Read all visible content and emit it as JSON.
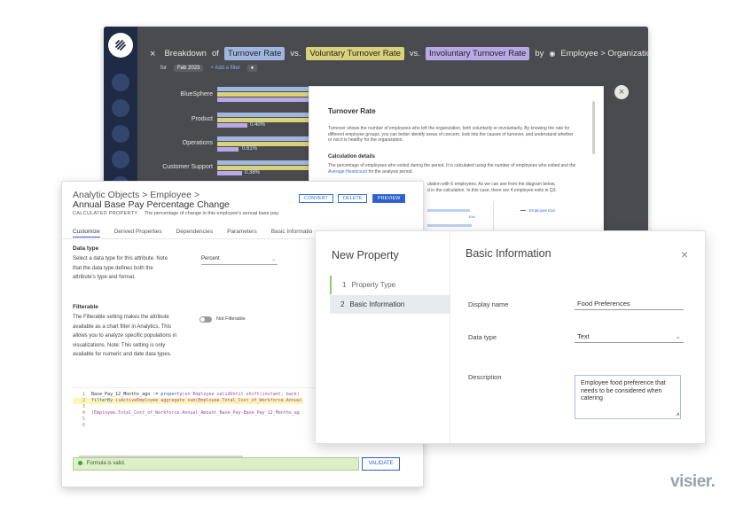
{
  "back_window": {
    "breadcrumb": {
      "close": "×",
      "w1": "Breakdown",
      "w2": "of",
      "metric1": "Turnover Rate",
      "vs1": "vs.",
      "metric2": "Voluntary Turnover Rate",
      "vs2": "vs.",
      "metric3": "Involuntary Turnover Rate",
      "by": "by",
      "dim_icon": "eye-icon",
      "dimension": "Employee > Organization Hierarchy"
    },
    "filters": {
      "for": "for",
      "period": "Feb 2023",
      "add": "+ Add a filter",
      "more": "♦"
    },
    "chart_data": {
      "type": "bar",
      "categories": [
        "BlueSphere",
        "Product",
        "Operations",
        "Customer Support"
      ],
      "data_labels": [
        "",
        "0.40%",
        "0.61%",
        "0.38%"
      ],
      "colors": {
        "series_a": "#9fb7e0",
        "series_b": "#d9d27a",
        "series_c": "#b8a9e6"
      }
    }
  },
  "turnover_panel": {
    "title": "Turnover Rate",
    "intro": "Turnover shows the number of employees who left the organization, both voluntarily or involuntarily. By knowing the rate for different employee groups, you can better identify areas of concern, look into the causes of turnover, and understand whether or not it is healthy for the organization.",
    "calc_title": "Calculation details",
    "calc_a": "The percentage of employees who exited during the period. It is calculated using the number of employees who exited and the",
    "calc_link": "Average Headcount",
    "calc_b": "for the analysis period.",
    "calc2_line1": "ulation with 6 employees. As we can see from the diagram below,",
    "calc2_line2": "d in the calculation. In this case, there are 4 employee exits in Q3.",
    "diagram_label": "Employee Exit",
    "diagram_small": "Exit",
    "close": "×"
  },
  "customize_window": {
    "breadcrumb": "Analytic Objects > Employee >",
    "title": "Annual Base Pay Percentage Change",
    "subtitle_kind": "CALCULATED PROPERTY",
    "subtitle_desc": "The percentage of change in this employee's annual base pay.",
    "buttons": {
      "convert": "CONVERT",
      "delete": "DELETE",
      "preview": "PREVIEW"
    },
    "tabs": [
      "Customize",
      "Derived Properties",
      "Dependencies",
      "Parameters",
      "Basic Informatio"
    ],
    "data_type": {
      "heading": "Data type",
      "desc": "Select a data type for this attribute. Note that the data type defines both the attribute's type and format.",
      "value": "Percent"
    },
    "filterable": {
      "heading": "Filterable",
      "desc": "The Filterable setting makes the attribute available as a chart filter in Analytics. This allows you to analyze specific populations in visualizations. Note: This setting is only available for numeric and date data types.",
      "toggle_label": "Not Filterable"
    },
    "code": {
      "lines": [
        {
          "n": "1",
          "a": "Base_Pay_12_Months_ago := ",
          "b": "property",
          "c": "(on Employee validUntil shift(instant, back("
        },
        {
          "n": "2",
          "a": "",
          "b": "filterBy",
          "c": " isActiveEmployee aggregate sum(Employee.Total_Cost_of_Workforce.Annual"
        },
        {
          "n": "3",
          "a": "",
          "b": "",
          "c": ""
        },
        {
          "n": "4",
          "a": "(Employee.Total_Cost_of_Workforce.Annual_Amount_Base_Pay-Base_Pay_12_Months_ag",
          "b": "",
          "c": ""
        },
        {
          "n": "5",
          "a": "",
          "b": "",
          "c": ""
        },
        {
          "n": "6",
          "a": "",
          "b": "",
          "c": ""
        }
      ]
    },
    "valid_message": "Formula is valid.",
    "validate": "VALIDATE"
  },
  "new_property": {
    "title": "New Property",
    "steps": [
      {
        "num": "1",
        "label": "Property Type"
      },
      {
        "num": "2",
        "label": "Basic Information"
      }
    ],
    "heading": "Basic Information",
    "close": "×",
    "fields": {
      "display_name_label": "Display name",
      "display_name_value": "Food Preferences",
      "data_type_label": "Data type",
      "data_type_value": "Text",
      "description_label": "Description",
      "description_value": "Employee food preference that needs to be considered when catering"
    }
  },
  "brand": "visier."
}
